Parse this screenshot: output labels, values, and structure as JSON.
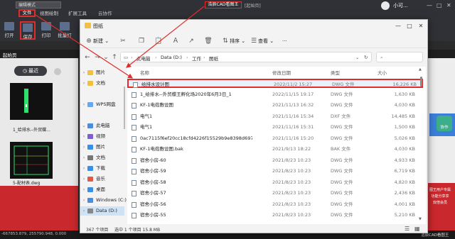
{
  "app": {
    "mode": "编辑模式",
    "menus": [
      "文件",
      "视图绘制",
      "扩展工具",
      "云协作"
    ],
    "tools": [
      {
        "label": "打开",
        "icon": "folder-open-icon"
      },
      {
        "label": "保存",
        "icon": "save-icon"
      },
      {
        "label": "打印",
        "icon": "printer-icon"
      },
      {
        "label": "批量打",
        "icon": "batch-print-icon"
      }
    ],
    "title_center": "浩辰CAD看图王",
    "title_sub": "[起始页]",
    "user": "小可...",
    "tab_label": "起始页",
    "recent_label": "最近",
    "thumbs": [
      "1_给排水--外贸蝶...",
      "5-配材表.dwg"
    ],
    "status_coords": "-667853.879, 255790.948, 0.000",
    "status_right": "浩辰CAD看图王",
    "right_badge": "协作",
    "right_promo": [
      "图王用户专属",
      "功能分享享",
      "双倍会员"
    ]
  },
  "dialog": {
    "title": "图纸",
    "toolbar": {
      "new": "新建",
      "sort": "排序",
      "view": "查看",
      "more": "···"
    },
    "breadcrumbs": [
      "此电脑",
      "Data (D:)",
      "工作",
      "图纸"
    ],
    "search_placeholder": "",
    "nav": [
      {
        "label": "图片",
        "chev": "›",
        "color": "#f0c040",
        "active": false
      },
      {
        "label": "文档",
        "chev": "›",
        "color": "#f0c040",
        "active": false
      },
      {
        "label": "",
        "chev": "",
        "color": "",
        "active": false
      },
      {
        "label": "WPS网盘",
        "chev": "›",
        "color": "#6aa6e8",
        "active": false
      },
      {
        "label": "",
        "chev": "",
        "color": "",
        "active": false
      },
      {
        "label": "此电脑",
        "chev": "⌄",
        "color": "#4a8de0",
        "active": false
      },
      {
        "label": "视频",
        "chev": "›",
        "color": "#7c5fd8",
        "active": false
      },
      {
        "label": "图片",
        "chev": "›",
        "color": "#3c8fe0",
        "active": false
      },
      {
        "label": "文档",
        "chev": "›",
        "color": "#777",
        "active": false
      },
      {
        "label": "下载",
        "chev": "›",
        "color": "#3c8fe0",
        "active": false
      },
      {
        "label": "音乐",
        "chev": "›",
        "color": "#e05a4a",
        "active": false
      },
      {
        "label": "桌面",
        "chev": "›",
        "color": "#3c8fe0",
        "active": false
      },
      {
        "label": "Windows (C:)",
        "chev": "›",
        "color": "#4a8de0",
        "active": false
      },
      {
        "label": "Data (D:)",
        "chev": "›",
        "color": "#888",
        "active": true
      }
    ],
    "columns": {
      "name": "名称",
      "date": "修改日期",
      "type": "类型",
      "size": "大小"
    },
    "files": [
      {
        "name": "给排水设计图",
        "date": "2022/11/2 15:27",
        "type": "DWG 文件",
        "size": "16,226 KB"
      },
      {
        "name": "1_给排水--外贸蝶王孵化场2020年6月3日_1",
        "date": "2022/11/15 19:17",
        "type": "DWG 文件",
        "size": "1,630 KB"
      },
      {
        "name": "KF-1电缆敷设图",
        "date": "2021/11/13 16:32",
        "type": "DWG 文件",
        "size": "4,030 KB"
      },
      {
        "name": "电气1",
        "date": "2021/11/16 15:34",
        "type": "DXF 文件",
        "size": "14,485 KB"
      },
      {
        "name": "电气1",
        "date": "2021/11/16 15:31",
        "type": "DWG 文件",
        "size": "1,500 KB"
      },
      {
        "name": "0ac7115f6ef20cc18cfd4226f15529b9e8398d69778a338eab...",
        "date": "2021/11/16 15:20",
        "type": "DWG 文件",
        "size": "5,026 KB"
      },
      {
        "name": "KF-1电缆敷设图.bak",
        "date": "2021/9/13 18:22",
        "type": "BAK 文件",
        "size": "4,030 KB"
      },
      {
        "name": "宿舍小房-60",
        "date": "2021/8/23 10:23",
        "type": "DWG 文件",
        "size": "4,933 KB"
      },
      {
        "name": "宿舍小房-59",
        "date": "2021/8/23 10:23",
        "type": "DWG 文件",
        "size": "6,719 KB"
      },
      {
        "name": "宿舍小房-58",
        "date": "2021/8/23 10:23",
        "type": "DWG 文件",
        "size": "4,820 KB"
      },
      {
        "name": "宿舍小房-57",
        "date": "2021/8/23 10:23",
        "type": "DWG 文件",
        "size": "2,436 KB"
      },
      {
        "name": "宿舍小房-56",
        "date": "2021/8/23 10:23",
        "type": "DWG 文件",
        "size": "4,001 KB"
      },
      {
        "name": "宿舍小房-55",
        "date": "2021/8/23 10:23",
        "type": "DWG 文件",
        "size": "5,210 KB"
      }
    ],
    "status_count": "367 个项目",
    "status_selected": "选中 1 个项目  15.8 MB"
  },
  "colors": {
    "highlight": "#e12c2c",
    "selection": "#e7f1fb",
    "app_bg": "#2f3136"
  }
}
